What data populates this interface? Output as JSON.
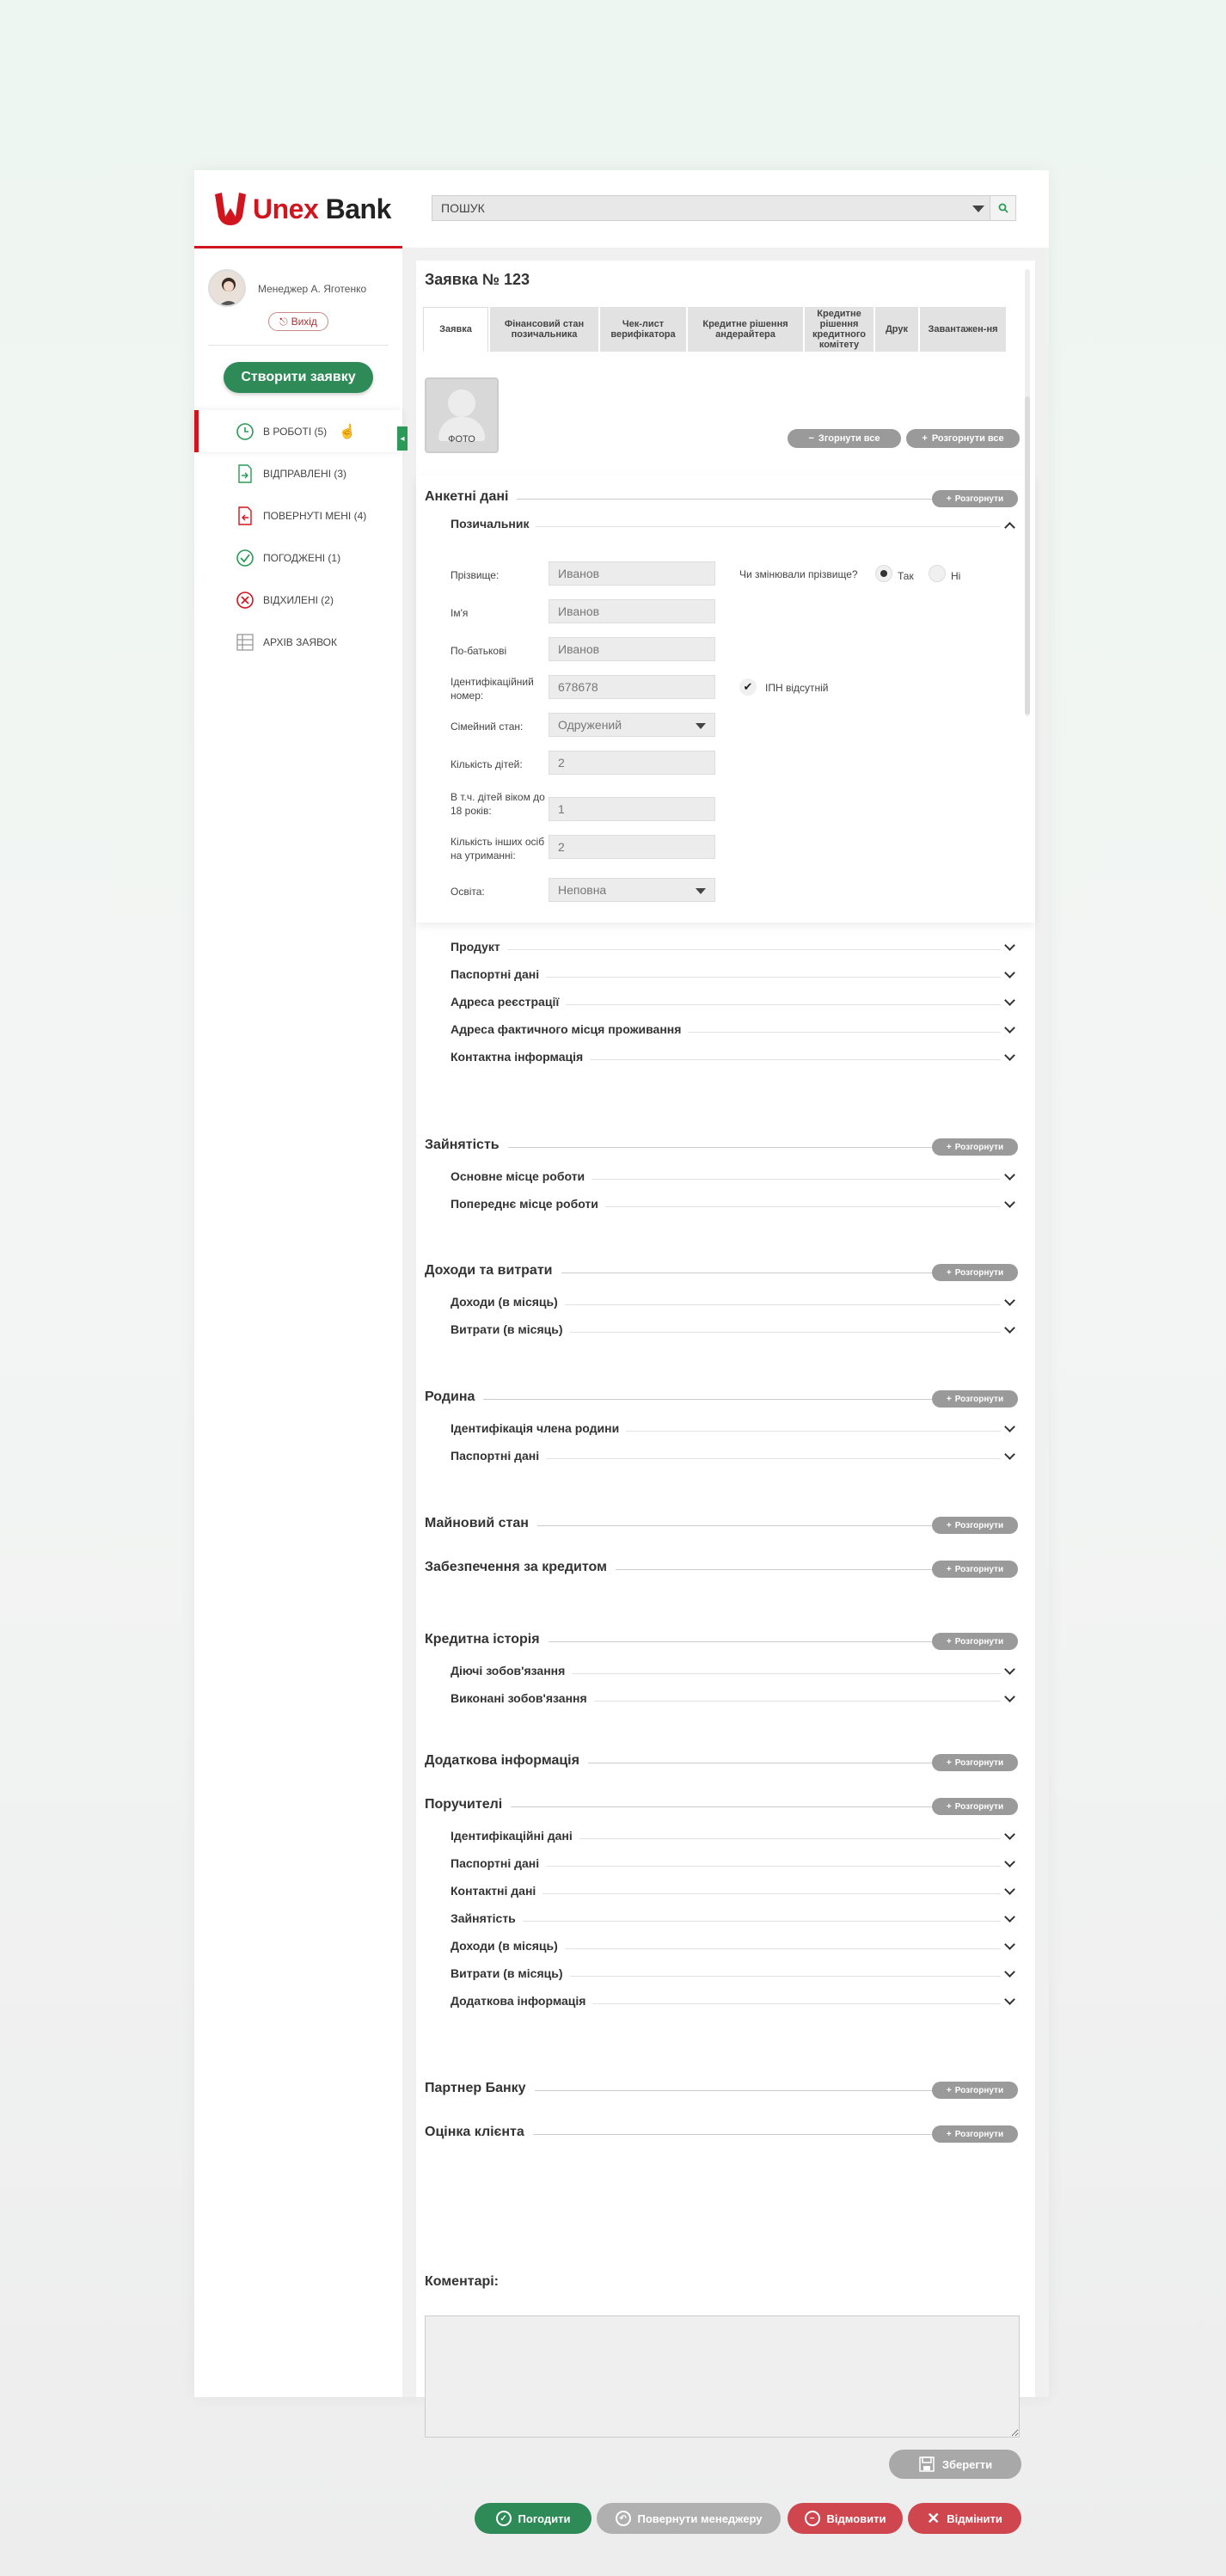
{
  "brand": {
    "name_red": "Unex",
    "name_dark": "Bank",
    "red": "#d0151e",
    "green": "#2e8b57"
  },
  "search": {
    "placeholder": "ПОШУК",
    "icon": "search-icon"
  },
  "user": {
    "manager": "Менеджер А. Яготенко",
    "logout": "Вихід"
  },
  "sidebar": {
    "create_button": "Створити заявку",
    "items": [
      {
        "label": "В РОБОТІ (5)",
        "icon": "clock-icon",
        "active": true
      },
      {
        "label": "ВІДПРАВЛЕНІ (3)",
        "icon": "sent-document-icon"
      },
      {
        "label": "ПОВЕРНУТІ МЕНІ (4)",
        "icon": "returned-document-icon"
      },
      {
        "label": "ПОГОДЖЕНІ (1)",
        "icon": "check-circle-icon"
      },
      {
        "label": "ВІДХИЛЕНІ (2)",
        "icon": "cross-circle-icon"
      },
      {
        "label": "АРХІВ ЗАЯВОК",
        "icon": "archive-icon"
      }
    ]
  },
  "main": {
    "title": "Заявка № 123",
    "tabs": [
      "Заявка",
      "Фінансовий стан позичальника",
      "Чек-лист верифікатора",
      "Кредитне рішення андерайтера",
      "Кредитне рішення кредитного комітету",
      "Друк",
      "Завантажен-ня"
    ],
    "photo_label": "ФОТО",
    "collapse_all": "Згорнути все",
    "expand_all": "Розгорнути все",
    "expand": "Розгорнути"
  },
  "form": {
    "section": "Анкетні дані",
    "subsection": "Позичальник",
    "surname_label": "Прізвище:",
    "surname_value": "Иванов",
    "name_label": "Ім'я",
    "name_value": "Иванов",
    "patronymic_label": "По-батькові",
    "patronymic_value": "Иванов",
    "id_label": "Ідентифікаційний номер:",
    "id_value": "678678",
    "marital_label": "Сімейний стан:",
    "marital_value": "Одружений",
    "children_label": "Кількість дітей:",
    "children_value": "2",
    "children18_label": "В т.ч. дітей віком до 18 років:",
    "children18_value": "1",
    "dependents_label": "Кількість інших осіб на утриманні:",
    "dependents_value": "2",
    "education_label": "Освіта:",
    "education_value": "Неповна",
    "surname_changed_label": "Чи змінювали прізвище?",
    "yes": "Так",
    "no": "Ні",
    "no_ipn": "ІПН відсутній"
  },
  "anketa_subs": [
    "Продукт",
    "Паспортні дані",
    "Адреса реєстрації",
    "Адреса фактичного місця проживання",
    "Контактна інформація"
  ],
  "sections": [
    {
      "title": "Зайнятість",
      "subs": [
        "Основне місце роботи",
        "Попереднє місце роботи"
      ]
    },
    {
      "title": "Доходи та витрати",
      "subs": [
        "Доходи (в місяць)",
        "Витрати (в місяць)"
      ]
    },
    {
      "title": "Родина",
      "subs": [
        "Ідентифікація члена родини",
        "Паспортні дані"
      ]
    },
    {
      "title": "Майновий стан",
      "subs": []
    },
    {
      "title": "Забезпечення за кредитом",
      "subs": []
    },
    {
      "title": "Кредитна історія",
      "subs": [
        "Діючі зобов'язання",
        "Виконані зобов'язання"
      ]
    },
    {
      "title": "Додаткова інформація",
      "subs": []
    },
    {
      "title": "Поручителі",
      "subs": [
        "Ідентифікаційні дані",
        "Паспортні дані",
        "Контактні дані",
        "Зайнятість",
        "Доходи (в місяць)",
        "Витрати (в місяць)",
        "Додаткова інформація"
      ]
    },
    {
      "title": "Партнер Банку",
      "subs": []
    },
    {
      "title": "Оцінка клієнта",
      "subs": []
    }
  ],
  "comments": {
    "label": "Коментарі:",
    "save": "Зберегти"
  },
  "actions": {
    "approve": "Погодити",
    "return_manager": "Повернути менеджеру",
    "refuse": "Відмовити",
    "decline": "Відмінити"
  }
}
